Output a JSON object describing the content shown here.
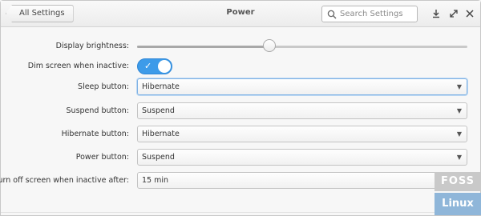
{
  "window": {
    "back_label": "All Settings",
    "title": "Power",
    "search_placeholder": "Search Settings"
  },
  "settings": {
    "brightness": {
      "label": "Display brightness:",
      "level_percent": 40
    },
    "dim_screen": {
      "label": "Dim screen when inactive:",
      "enabled": true
    },
    "sleep_button": {
      "label": "Sleep button:",
      "value": "Hibernate"
    },
    "suspend_button": {
      "label": "Suspend button:",
      "value": "Suspend"
    },
    "hibernate_button": {
      "label": "Hibernate button:",
      "value": "Hibernate"
    },
    "power_button": {
      "label": "Power button:",
      "value": "Suspend"
    },
    "screen_off": {
      "label": "Turn off screen when inactive after:",
      "value": "15 min"
    }
  },
  "watermark": {
    "line1": "FOSS",
    "line2": "Linux"
  },
  "colors": {
    "accent": "#3d9be9",
    "focus_border": "#7fb2e5"
  }
}
